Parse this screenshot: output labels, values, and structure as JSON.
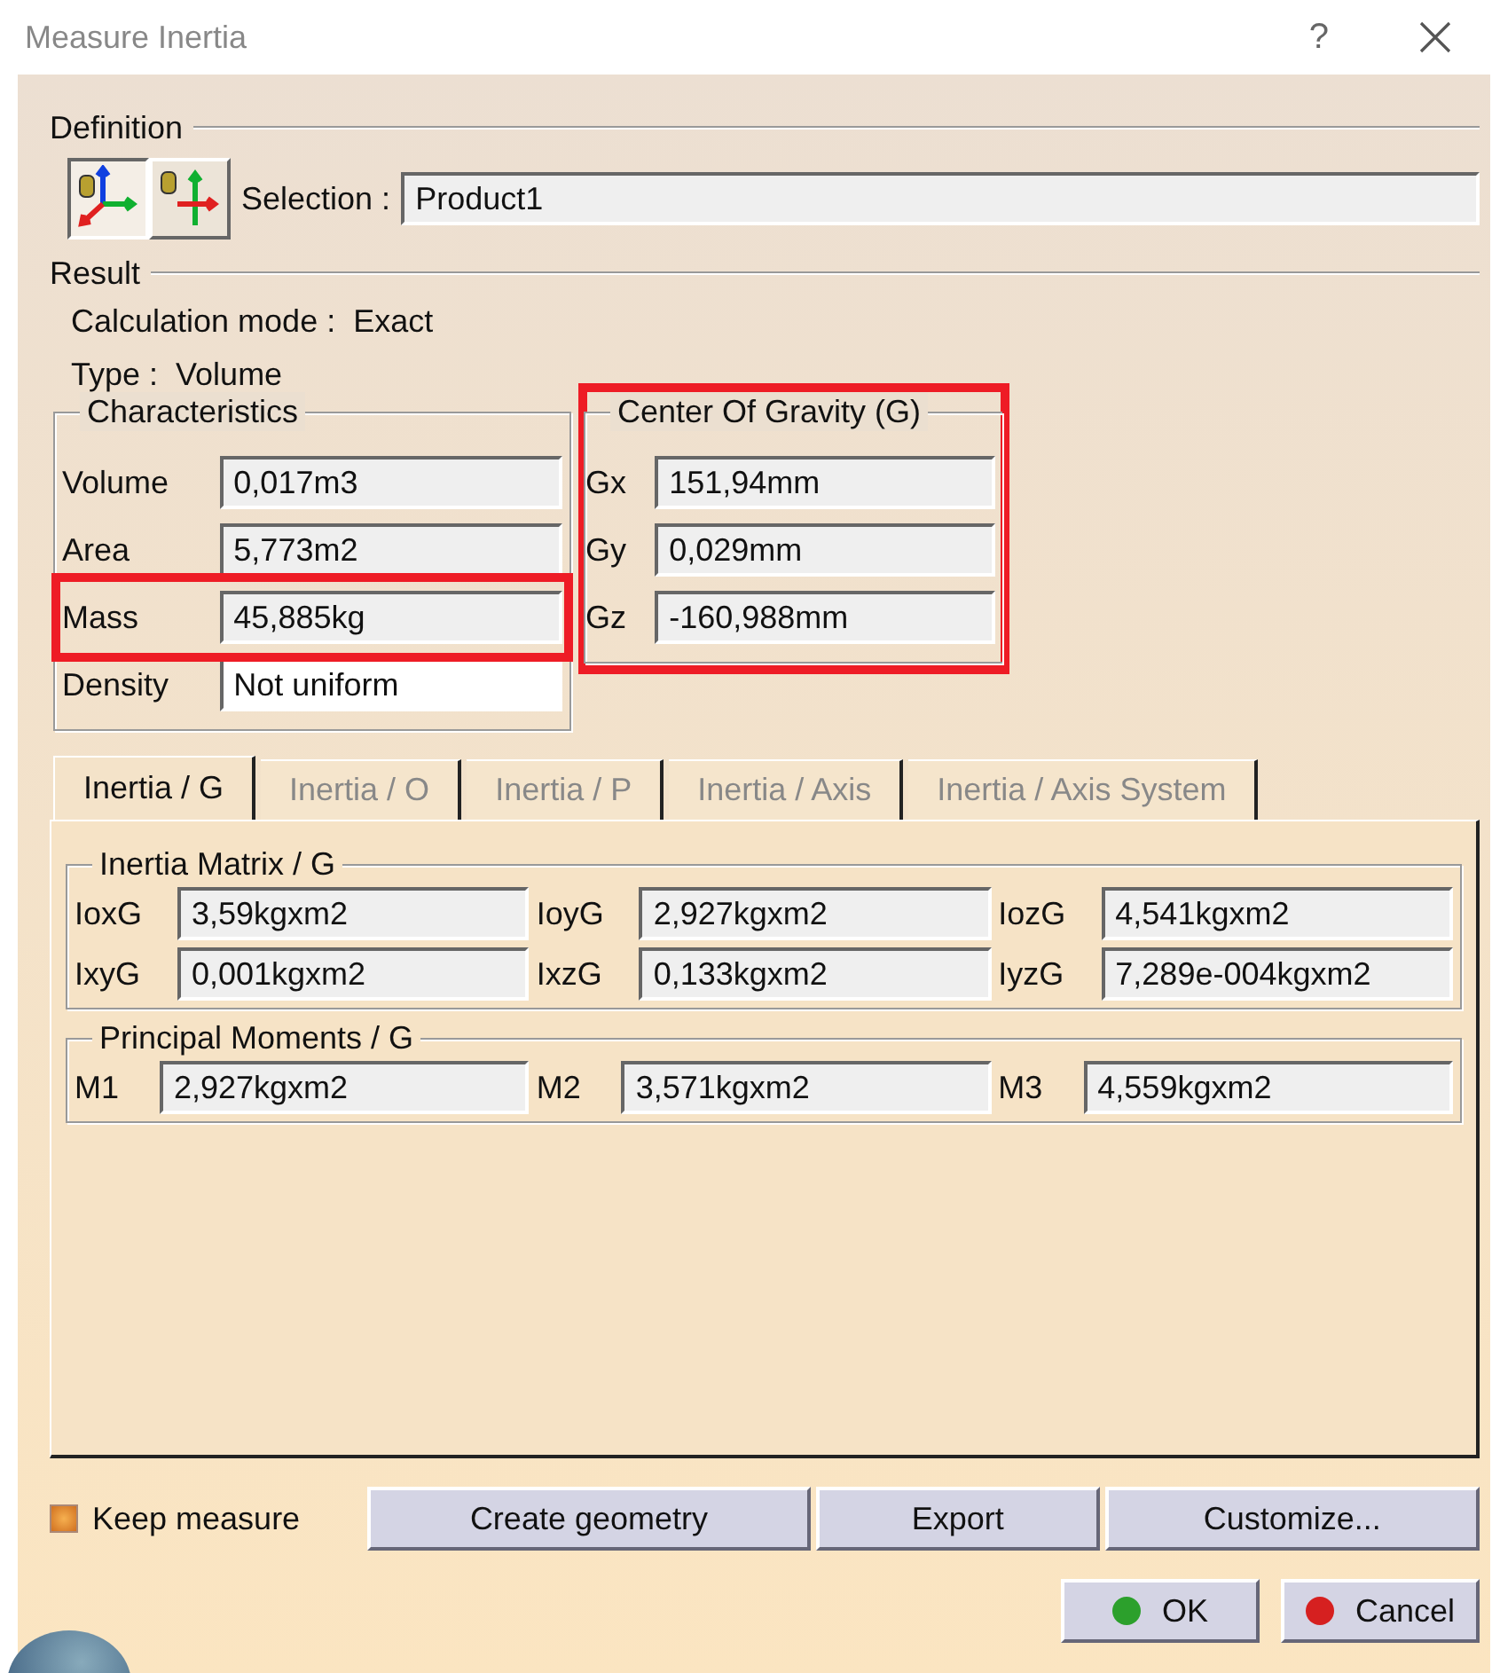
{
  "window": {
    "title": "Measure Inertia",
    "help": "?"
  },
  "definition": {
    "label": "Definition",
    "selection_label": "Selection :",
    "selection_value": "Product1"
  },
  "result": {
    "label": "Result",
    "calc_mode_label": "Calculation mode :",
    "calc_mode": "Exact",
    "type_label": "Type :",
    "type": "Volume"
  },
  "characteristics": {
    "title": "Characteristics",
    "rows": [
      {
        "label": "Volume",
        "value": "0,017m3",
        "highlighted": false,
        "kind": "readonly"
      },
      {
        "label": "Area",
        "value": "5,773m2",
        "highlighted": false,
        "kind": "readonly"
      },
      {
        "label": "Mass",
        "value": "45,885kg",
        "highlighted": true,
        "kind": "readonly"
      },
      {
        "label": "Density",
        "value": "Not uniform",
        "highlighted": false,
        "kind": "editable"
      }
    ]
  },
  "center_of_gravity": {
    "title": "Center Of Gravity (G)",
    "highlighted": true,
    "rows": [
      {
        "label": "Gx",
        "value": "151,94mm"
      },
      {
        "label": "Gy",
        "value": "0,029mm"
      },
      {
        "label": "Gz",
        "value": "-160,988mm"
      }
    ]
  },
  "tabs": [
    {
      "label": "Inertia / G",
      "selected": true
    },
    {
      "label": "Inertia / O",
      "selected": false
    },
    {
      "label": "Inertia / P",
      "selected": false
    },
    {
      "label": "Inertia / Axis",
      "selected": false
    },
    {
      "label": "Inertia / Axis System",
      "selected": false
    }
  ],
  "inertia_matrix": {
    "title": "Inertia Matrix / G",
    "cells": [
      {
        "label": "IoxG",
        "value": "3,59kgxm2"
      },
      {
        "label": "IoyG",
        "value": "2,927kgxm2"
      },
      {
        "label": "IozG",
        "value": "4,541kgxm2"
      },
      {
        "label": "IxyG",
        "value": "0,001kgxm2"
      },
      {
        "label": "IxzG",
        "value": "0,133kgxm2"
      },
      {
        "label": "IyzG",
        "value": "7,289e-004kgxm2"
      }
    ]
  },
  "principal_moments": {
    "title": "Principal Moments / G",
    "cells": [
      {
        "label": "M1",
        "value": "2,927kgxm2"
      },
      {
        "label": "M2",
        "value": "3,571kgxm2"
      },
      {
        "label": "M3",
        "value": "4,559kgxm2"
      }
    ]
  },
  "keep_measure": {
    "label": "Keep measure",
    "checked": true
  },
  "buttons": [
    "Create geometry",
    "Export",
    "Customize..."
  ],
  "dialog_buttons": [
    {
      "label": "OK",
      "kind": "ok"
    },
    {
      "label": "Cancel",
      "kind": "cancel"
    }
  ]
}
